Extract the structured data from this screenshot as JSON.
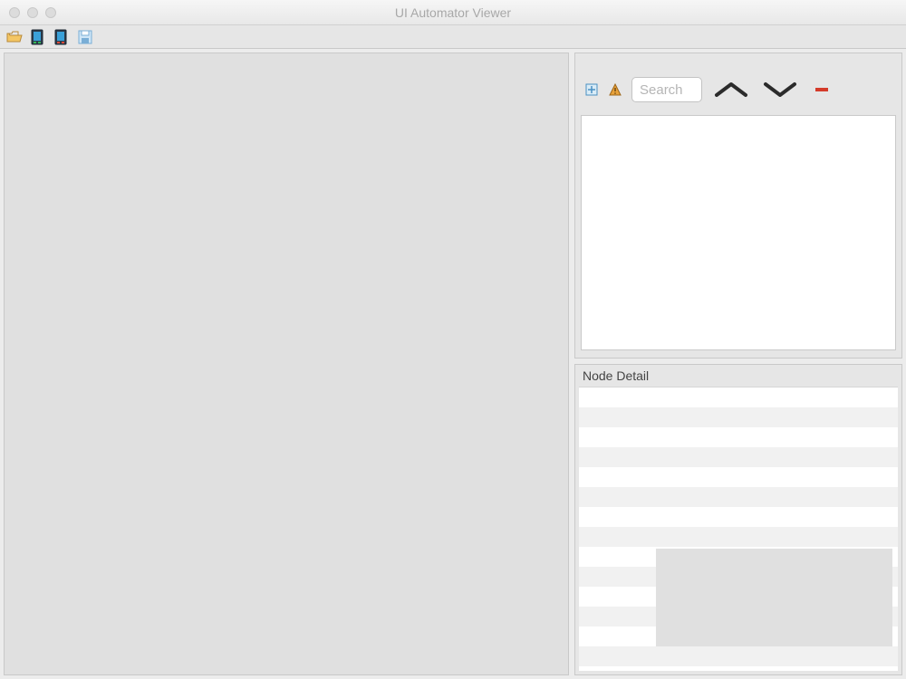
{
  "window": {
    "title": "UI Automator Viewer"
  },
  "toolbar": {
    "icons": {
      "open": "open-folder-icon",
      "screenshot": "device-screenshot-icon",
      "screenshot_compressed": "device-screenshot-compressed-icon",
      "save": "save-icon"
    }
  },
  "tree_panel": {
    "expand_icon": "expand-all-icon",
    "naf_icon": "naf-warning-icon",
    "search_placeholder": "Search",
    "prev_icon": "chevron-up-icon",
    "next_icon": "chevron-down-icon",
    "remove_icon": "remove-icon"
  },
  "detail_panel": {
    "title": "Node Detail"
  }
}
